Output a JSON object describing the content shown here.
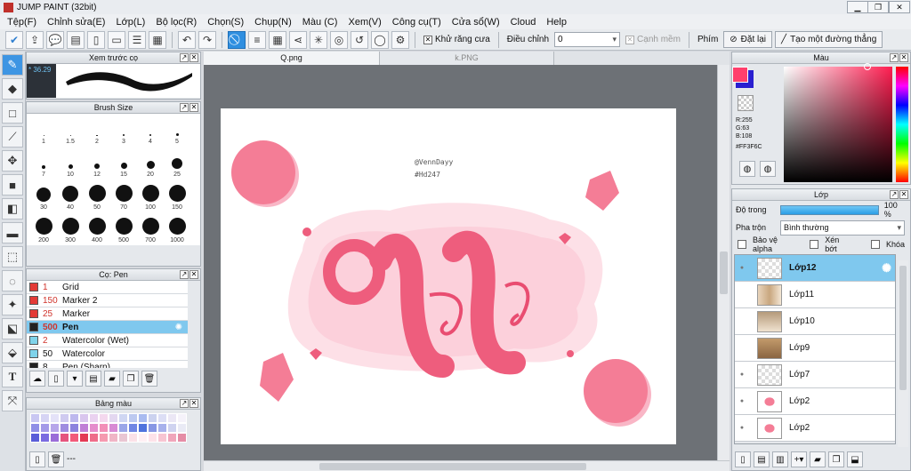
{
  "window": {
    "title": "JUMP PAINT (32bit)",
    "min": "▁",
    "max": "❐",
    "close": "✕"
  },
  "menu": [
    "Tệp(F)",
    "Chỉnh sửa(E)",
    "Lớp(L)",
    "Bộ lọc(R)",
    "Chọn(S)",
    "Chụp(N)",
    "Màu (C)",
    "Xem(V)",
    "Công cụ(T)",
    "Cửa sổ(W)",
    "Cloud",
    "Help"
  ],
  "toolbar": {
    "antialias_label": "Khử răng cưa",
    "adjust_label": "Điều chỉnh",
    "adjust_value": "0",
    "snap_label": "Cạnh mềm",
    "key_label": "Phím",
    "reset_label": "Đặt lại",
    "straight_label": "Tạo một đường thẳng"
  },
  "brush_preview": {
    "title": "Xem trước cọ",
    "size_text": "* 36.29"
  },
  "brush_size": {
    "title": "Brush Size",
    "sizes": [
      "1",
      "1.5",
      "2",
      "3",
      "4",
      "5",
      "7",
      "10",
      "12",
      "15",
      "20",
      "25",
      "30",
      "40",
      "50",
      "70",
      "100",
      "150",
      "200",
      "300",
      "400",
      "500",
      "700",
      "1000"
    ]
  },
  "brush_list": {
    "title": "Cọ: Pen",
    "items": [
      {
        "size": "1",
        "name": "Grid",
        "color": "#e33a36"
      },
      {
        "size": "150",
        "name": "Marker 2",
        "color": "#e33a36"
      },
      {
        "size": "25",
        "name": "Marker",
        "color": "#e33a36"
      },
      {
        "size": "500",
        "name": "Pen",
        "color": "#222222",
        "selected": true
      },
      {
        "size": "2",
        "name": "Watercolor (Wet)",
        "color": "#7fd3ea"
      },
      {
        "size": "50",
        "name": "Watercolor",
        "color": "#7fd3ea"
      },
      {
        "size": "8",
        "name": "Pen (Sharp)",
        "color": "#222222"
      }
    ]
  },
  "palette": {
    "title": "Bảng màu",
    "footer": "---",
    "colors": [
      "#c9c7f2",
      "#d6d4f4",
      "#e4e2f8",
      "#cfcaf0",
      "#bdb8ee",
      "#d9c6ee",
      "#ead2f0",
      "#f4d8ee",
      "#e3d7f0",
      "#cfd6f2",
      "#bcc9f0",
      "#a9bbf0",
      "#cbd2ef",
      "#dcdef5",
      "#ebe7f5",
      "#f5f2fa",
      "#8f8ee6",
      "#a49ae8",
      "#b7a6ea",
      "#9f8de0",
      "#8c83de",
      "#c07fd6",
      "#e58dcc",
      "#f28fb8",
      "#d88ad4",
      "#9aa6e8",
      "#6f86e4",
      "#4f73dd",
      "#8797e4",
      "#a7b1ec",
      "#cfd3f0",
      "#e9eaf5",
      "#5a5dd8",
      "#7a6be0",
      "#9a6dd8",
      "#e5557e",
      "#f25b7a",
      "#e33a55",
      "#ee6d8a",
      "#f59ab0",
      "#f0b5c6",
      "#e9c6d3",
      "#fbe1e8",
      "#fff0f4",
      "#fde2e9",
      "#f7c5d2",
      "#f0a6bb",
      "#e58da6"
    ]
  },
  "tabs": [
    "Q.png",
    "k.PNG"
  ],
  "artwork": {
    "watermark1": "@VennDayy",
    "watermark2": "#Hd247"
  },
  "color_panel": {
    "title": "Màu",
    "r": "R:255",
    "g": "G:63",
    "b": "B:108",
    "hex": "#FF3F6C"
  },
  "layer_panel": {
    "title": "Lớp",
    "opacity_label": "Độ trong",
    "opacity_value": "100 %",
    "blend_label": "Pha trộn",
    "blend_value": "Bình thường",
    "protect_alpha": "Bảo vệ alpha",
    "clip": "Xén bớt",
    "lock": "Khóa",
    "layers": [
      "Lớp12",
      "Lớp11",
      "Lớp10",
      "Lớp9",
      "Lớp7",
      "Lớp2",
      "Lớp2"
    ]
  }
}
